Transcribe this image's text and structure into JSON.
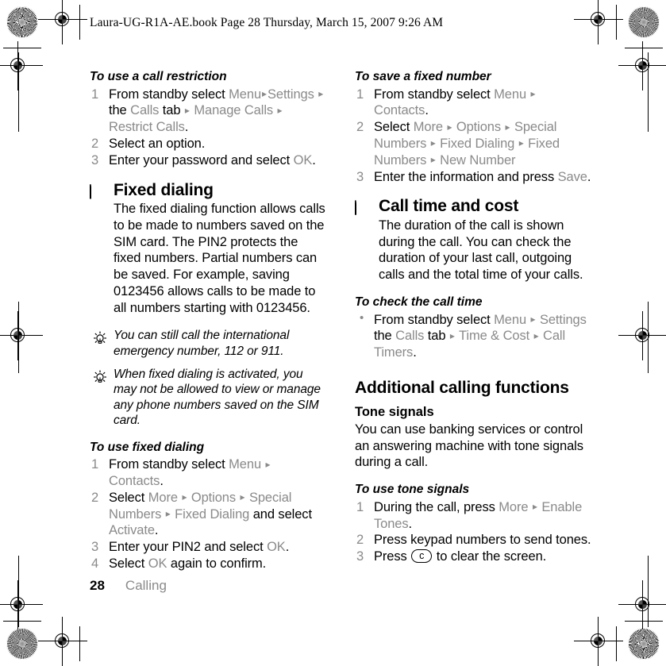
{
  "document": {
    "header_slug": "Laura-UG-R1A-AE.book  Page 28  Thursday, March 15, 2007  9:26 AM",
    "footer": {
      "page_number": "28",
      "chapter": "Calling"
    }
  },
  "colors": {
    "ui_term_gray": "#8a8a8a",
    "body_text": "#000000",
    "page_background": "#ffffff"
  },
  "left_column": {
    "task_call_restriction": {
      "heading": "To use a call restriction",
      "steps": [
        {
          "parts": [
            {
              "t": "From standby select ",
              "s": "plain"
            },
            {
              "t": "Menu",
              "s": "ui"
            },
            {
              "t": "▸",
              "s": "arr"
            },
            {
              "t": "Settings",
              "s": "ui"
            },
            {
              "t": " ",
              "s": "plain"
            },
            {
              "t": "▸",
              "s": "arr"
            },
            {
              "t": " the ",
              "s": "plain"
            },
            {
              "t": "Calls",
              "s": "ui"
            },
            {
              "t": " tab ",
              "s": "plain"
            },
            {
              "t": "▸",
              "s": "arr"
            },
            {
              "t": " ",
              "s": "plain"
            },
            {
              "t": "Manage Calls",
              "s": "ui"
            },
            {
              "t": " ",
              "s": "plain"
            },
            {
              "t": "▸",
              "s": "arr"
            },
            {
              "t": " ",
              "s": "plain"
            },
            {
              "t": "Restrict Calls",
              "s": "ui"
            },
            {
              "t": ".",
              "s": "plain"
            }
          ]
        },
        {
          "parts": [
            {
              "t": "Select an option.",
              "s": "plain"
            }
          ]
        },
        {
          "parts": [
            {
              "t": "Enter your password and select ",
              "s": "plain"
            },
            {
              "t": "OK",
              "s": "ui"
            },
            {
              "t": ".",
              "s": "plain"
            }
          ]
        }
      ]
    },
    "section_fixed_dialing": {
      "icon": "sim-card-antenna-icon",
      "heading": "Fixed dialing",
      "body": "The fixed dialing function allows calls to be made to numbers saved on the SIM card. The PIN2 protects the fixed numbers. Partial numbers can be saved. For example, saving 0123456 allows calls to be made to all numbers starting with 0123456."
    },
    "tips": [
      {
        "icon": "lightbulb-tip-icon",
        "text": "You can still call the international emergency number, 112 or 911."
      },
      {
        "icon": "lightbulb-tip-icon",
        "text": "When fixed dialing is activated, you may not be allowed to view or manage any phone numbers saved on the SIM card."
      }
    ],
    "task_use_fixed_dialing": {
      "heading": "To use fixed dialing",
      "steps": [
        {
          "parts": [
            {
              "t": "From standby select ",
              "s": "plain"
            },
            {
              "t": "Menu",
              "s": "ui"
            },
            {
              "t": " ",
              "s": "plain"
            },
            {
              "t": "▸",
              "s": "arr"
            },
            {
              "t": " ",
              "s": "plain"
            },
            {
              "t": "Contacts",
              "s": "ui"
            },
            {
              "t": ".",
              "s": "plain"
            }
          ]
        },
        {
          "parts": [
            {
              "t": "Select ",
              "s": "plain"
            },
            {
              "t": "More",
              "s": "ui"
            },
            {
              "t": " ",
              "s": "plain"
            },
            {
              "t": "▸",
              "s": "arr"
            },
            {
              "t": " ",
              "s": "plain"
            },
            {
              "t": "Options",
              "s": "ui"
            },
            {
              "t": " ",
              "s": "plain"
            },
            {
              "t": "▸",
              "s": "arr"
            },
            {
              "t": " ",
              "s": "plain"
            },
            {
              "t": "Special Numbers",
              "s": "ui"
            },
            {
              "t": " ",
              "s": "plain"
            },
            {
              "t": "▸",
              "s": "arr"
            },
            {
              "t": " ",
              "s": "plain"
            },
            {
              "t": "Fixed Dialing",
              "s": "ui"
            },
            {
              "t": " and select ",
              "s": "plain"
            },
            {
              "t": "Activate",
              "s": "ui"
            },
            {
              "t": ".",
              "s": "plain"
            }
          ]
        },
        {
          "parts": [
            {
              "t": "Enter your PIN2 and select ",
              "s": "plain"
            },
            {
              "t": "OK",
              "s": "ui"
            },
            {
              "t": ".",
              "s": "plain"
            }
          ]
        },
        {
          "parts": [
            {
              "t": "Select ",
              "s": "plain"
            },
            {
              "t": "OK",
              "s": "ui"
            },
            {
              "t": " again to confirm.",
              "s": "plain"
            }
          ]
        }
      ]
    }
  },
  "right_column": {
    "task_save_fixed_number": {
      "heading": "To save a fixed number",
      "steps": [
        {
          "parts": [
            {
              "t": "From standby select ",
              "s": "plain"
            },
            {
              "t": "Menu",
              "s": "ui"
            },
            {
              "t": " ",
              "s": "plain"
            },
            {
              "t": "▸",
              "s": "arr"
            },
            {
              "t": " ",
              "s": "plain"
            },
            {
              "t": "Contacts",
              "s": "ui"
            },
            {
              "t": ".",
              "s": "plain"
            }
          ]
        },
        {
          "parts": [
            {
              "t": "Select ",
              "s": "plain"
            },
            {
              "t": "More",
              "s": "ui"
            },
            {
              "t": " ",
              "s": "plain"
            },
            {
              "t": "▸",
              "s": "arr"
            },
            {
              "t": " ",
              "s": "plain"
            },
            {
              "t": "Options",
              "s": "ui"
            },
            {
              "t": " ",
              "s": "plain"
            },
            {
              "t": "▸",
              "s": "arr"
            },
            {
              "t": " ",
              "s": "plain"
            },
            {
              "t": "Special Numbers",
              "s": "ui"
            },
            {
              "t": " ",
              "s": "plain"
            },
            {
              "t": "▸",
              "s": "arr"
            },
            {
              "t": " ",
              "s": "plain"
            },
            {
              "t": "Fixed Dialing",
              "s": "ui"
            },
            {
              "t": " ",
              "s": "plain"
            },
            {
              "t": "▸",
              "s": "arr"
            },
            {
              "t": " ",
              "s": "plain"
            },
            {
              "t": "Fixed Numbers",
              "s": "ui"
            },
            {
              "t": " ",
              "s": "plain"
            },
            {
              "t": "▸",
              "s": "arr"
            },
            {
              "t": " ",
              "s": "plain"
            },
            {
              "t": "New Number",
              "s": "ui"
            }
          ]
        },
        {
          "parts": [
            {
              "t": "Enter the information and press ",
              "s": "plain"
            },
            {
              "t": "Save",
              "s": "ui"
            },
            {
              "t": ".",
              "s": "plain"
            }
          ]
        }
      ]
    },
    "section_call_time_cost": {
      "icon": "sim-card-antenna-icon",
      "heading": "Call time and cost",
      "body": "The duration of the call is shown during the call. You can check the duration of your last call, outgoing calls and the total time of your calls."
    },
    "task_check_call_time": {
      "heading": "To check the call time",
      "bullets": [
        {
          "parts": [
            {
              "t": "From standby select ",
              "s": "plain"
            },
            {
              "t": "Menu",
              "s": "ui"
            },
            {
              "t": " ",
              "s": "plain"
            },
            {
              "t": "▸",
              "s": "arr"
            },
            {
              "t": " ",
              "s": "plain"
            },
            {
              "t": "Settings",
              "s": "ui"
            },
            {
              "t": " the ",
              "s": "plain"
            },
            {
              "t": "Calls",
              "s": "ui"
            },
            {
              "t": " tab ",
              "s": "plain"
            },
            {
              "t": "▸",
              "s": "arr"
            },
            {
              "t": " ",
              "s": "plain"
            },
            {
              "t": "Time & Cost",
              "s": "ui"
            },
            {
              "t": " ",
              "s": "plain"
            },
            {
              "t": "▸",
              "s": "arr"
            },
            {
              "t": " ",
              "s": "plain"
            },
            {
              "t": "Call Timers",
              "s": "ui"
            },
            {
              "t": ".",
              "s": "plain"
            }
          ]
        }
      ]
    },
    "section_additional": {
      "heading": "Additional calling functions",
      "subsection": {
        "heading": "Tone signals",
        "body": "You can use banking services or control an answering machine with tone signals during a call."
      },
      "task_tone_signals": {
        "heading": "To use tone signals",
        "steps": [
          {
            "parts": [
              {
                "t": "During the call, press ",
                "s": "plain"
              },
              {
                "t": "More",
                "s": "ui"
              },
              {
                "t": " ",
                "s": "plain"
              },
              {
                "t": "▸",
                "s": "arr"
              },
              {
                "t": " ",
                "s": "plain"
              },
              {
                "t": "Enable Tones",
                "s": "ui"
              },
              {
                "t": ".",
                "s": "plain"
              }
            ]
          },
          {
            "parts": [
              {
                "t": "Press keypad numbers to send tones.",
                "s": "plain"
              }
            ]
          },
          {
            "parts": [
              {
                "t": "Press ",
                "s": "plain"
              },
              {
                "t": "c",
                "s": "key"
              },
              {
                "t": " to clear the screen.",
                "s": "plain"
              }
            ]
          }
        ]
      }
    }
  }
}
